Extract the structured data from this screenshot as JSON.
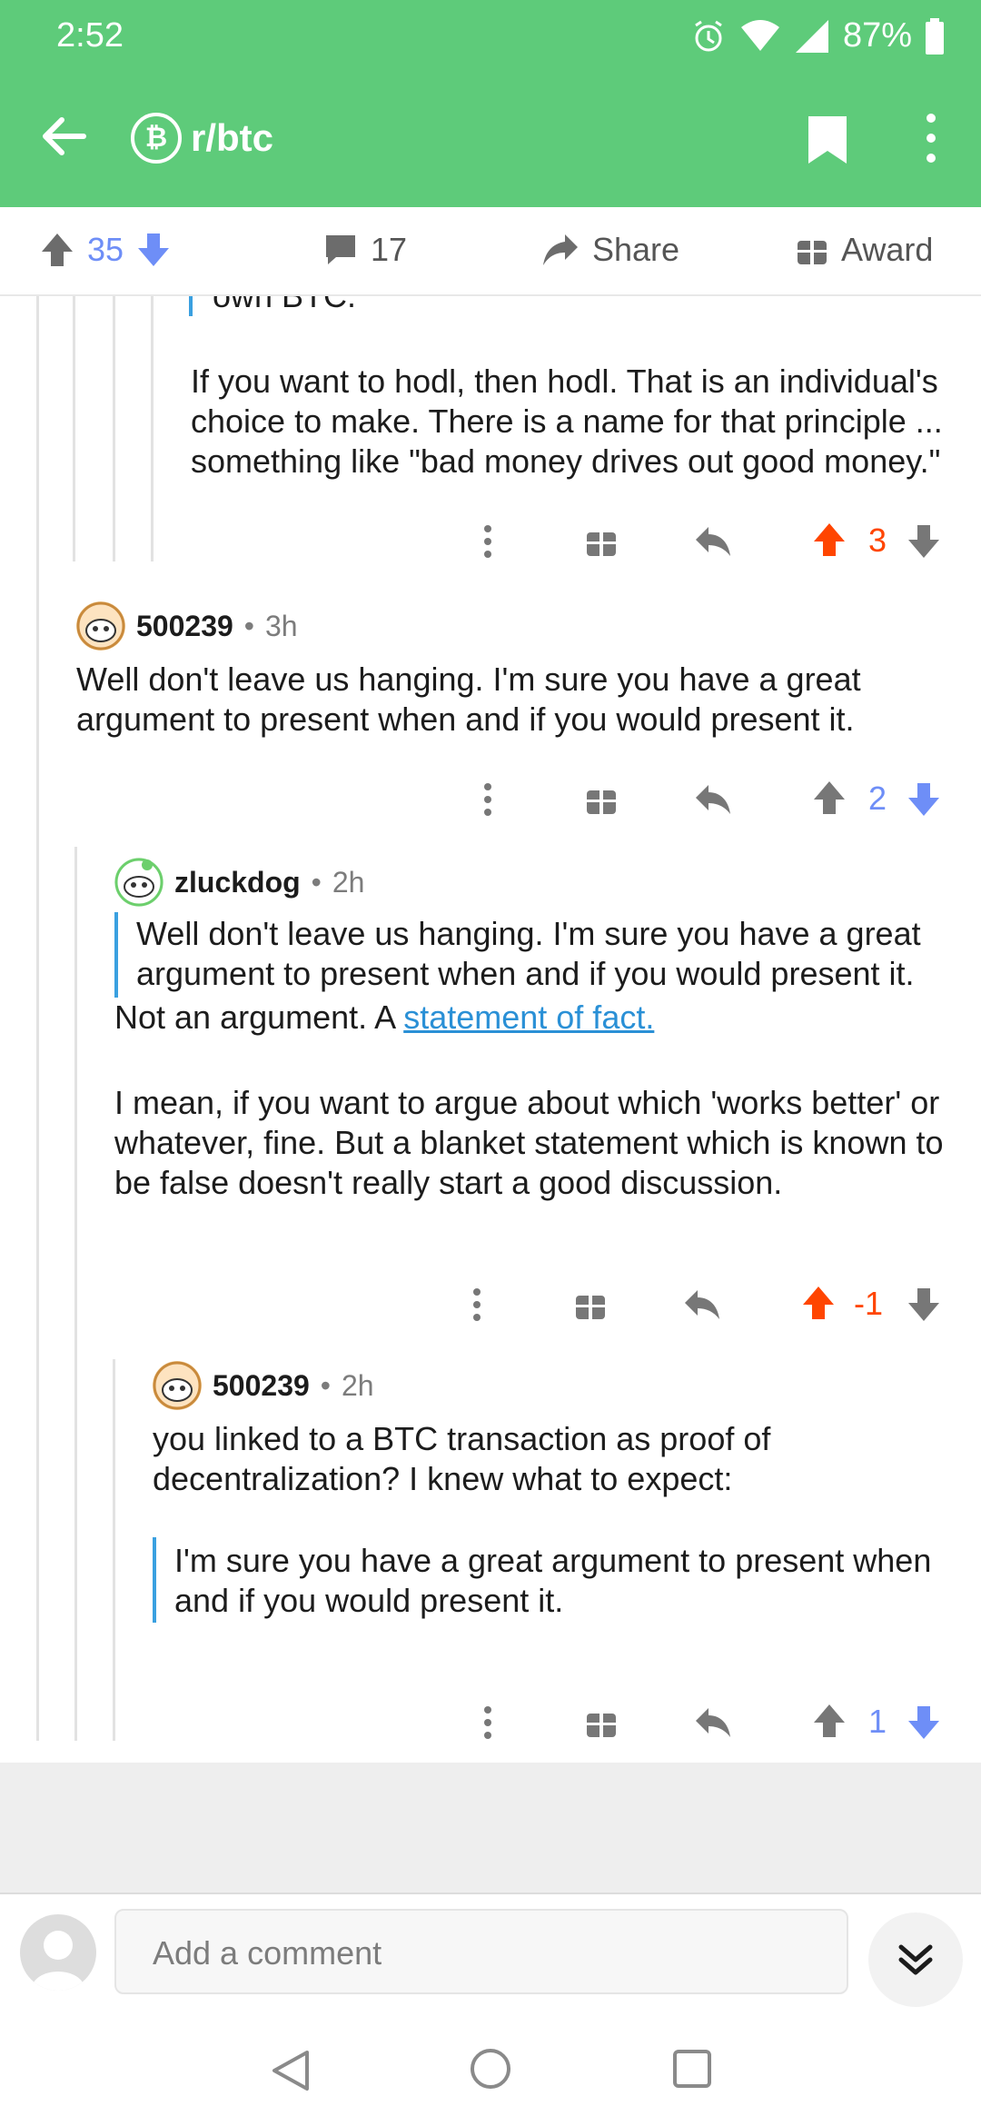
{
  "status": {
    "time": "2:52",
    "battery": "87%"
  },
  "appbar": {
    "subreddit": "r/btc",
    "sub_icon_glyph": "₿"
  },
  "post_actions": {
    "votes": "35",
    "comments": "17",
    "share": "Share",
    "award": "Award"
  },
  "comments": {
    "top_clipped": {
      "text_tail": "own BTC.",
      "text": "If you want to hodl, then hodl. That is an individual's choice to make. There is a name for that principle ... something like \"bad money drives out good money.\"",
      "score": "3"
    },
    "c1": {
      "user": "500239",
      "time": "3h",
      "text": "Well don't leave us hanging. I'm sure you have a great argument to present when and if you would present it.",
      "score": "2"
    },
    "c2": {
      "user": "zluckdog",
      "time": "2h",
      "quote": "Well don't leave us hanging. I'm sure you have a great argument to present when and if you would present it.",
      "line1_prefix": "Not an argument. A ",
      "line1_link": "statement of fact.",
      "text2": "I mean, if you want to argue about which 'works better' or whatever, fine. But a blanket statement which is known to be false doesn't really start a good discussion.",
      "score": "-1"
    },
    "c3": {
      "user": "500239",
      "time": "2h",
      "text": "you linked to a BTC transaction as proof of decentralization? I knew what to expect:",
      "quote": "I'm sure you have a great argument to present when and if you would present it.",
      "score": "1"
    }
  },
  "meta_separator": "•",
  "input": {
    "placeholder": "Add a comment"
  },
  "colors": {
    "header_green": "#5ecb7a",
    "upvote_active": "#ff4500",
    "downvote_active": "#6e8ef7",
    "link": "#2a90d6",
    "quote_bar": "#3aa0e0"
  },
  "icons": [
    "back-arrow-icon",
    "bitcoin-icon",
    "bookmark-icon",
    "kebab-icon",
    "upvote-icon",
    "downvote-icon",
    "comment-icon",
    "share-icon",
    "gift-icon",
    "reply-icon",
    "more-icon",
    "expand-icon"
  ]
}
